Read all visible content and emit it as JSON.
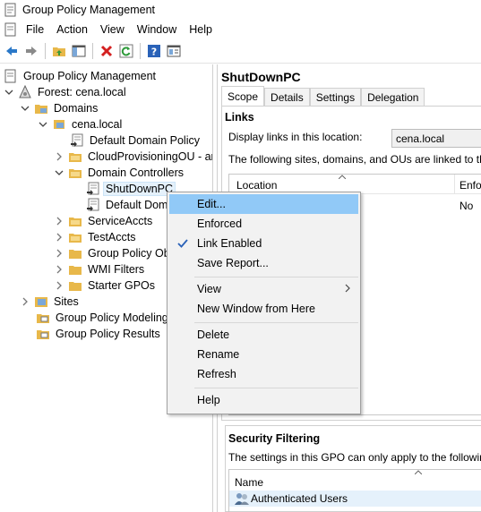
{
  "window": {
    "title": "Group Policy Management"
  },
  "menubar": {
    "items": [
      "File",
      "Action",
      "View",
      "Window",
      "Help"
    ]
  },
  "toolbar": {
    "buttons": [
      "back-icon",
      "forward-icon",
      "folder-up-icon",
      "show-hide-tree-icon",
      "delete-icon",
      "refresh-icon",
      "help-icon",
      "properties-icon"
    ]
  },
  "tree": {
    "root": "Group Policy Management",
    "forest": "Forest: cena.local",
    "domains": "Domains",
    "domain": "cena.local",
    "default_domain_policy": "Default Domain Policy",
    "cloud_ou": "CloudProvisioningOU - ar",
    "domain_controllers": "Domain Controllers",
    "shutdownpc": "ShutDownPC",
    "default_dom": "Default Dom",
    "serviceaccts": "ServiceAccts",
    "testaccts": "TestAccts",
    "gpo_objects": "Group Policy Ob",
    "wmi_filters": "WMI Filters",
    "starter_gpos": "Starter GPOs",
    "sites": "Sites",
    "modeling": "Group Policy Modeling",
    "results": "Group Policy Results"
  },
  "details": {
    "title": "ShutDownPC",
    "tabs": [
      "Scope",
      "Details",
      "Settings",
      "Delegation"
    ],
    "links_heading": "Links",
    "display_links_label": "Display links in this location:",
    "display_links_value": "cena.local",
    "following_text": "The following sites, domains, and OUs are linked to this GPO",
    "col_location": "Location",
    "col_enforced": "Enfo",
    "enforced_value": "No",
    "security_heading": "Security Filtering",
    "security_desc": "The settings in this GPO can only apply to the following grou",
    "col_name": "Name",
    "security_row": "Authenticated Users"
  },
  "context_menu": {
    "edit": "Edit...",
    "enforced": "Enforced",
    "link_enabled": "Link Enabled",
    "save_report": "Save Report...",
    "view": "View",
    "new_window": "New Window from Here",
    "delete": "Delete",
    "rename": "Rename",
    "refresh": "Refresh",
    "help": "Help"
  },
  "colors": {
    "highlight": "#91c9f7",
    "selection": "#e5f1fb",
    "folder": "#e8b84a"
  }
}
